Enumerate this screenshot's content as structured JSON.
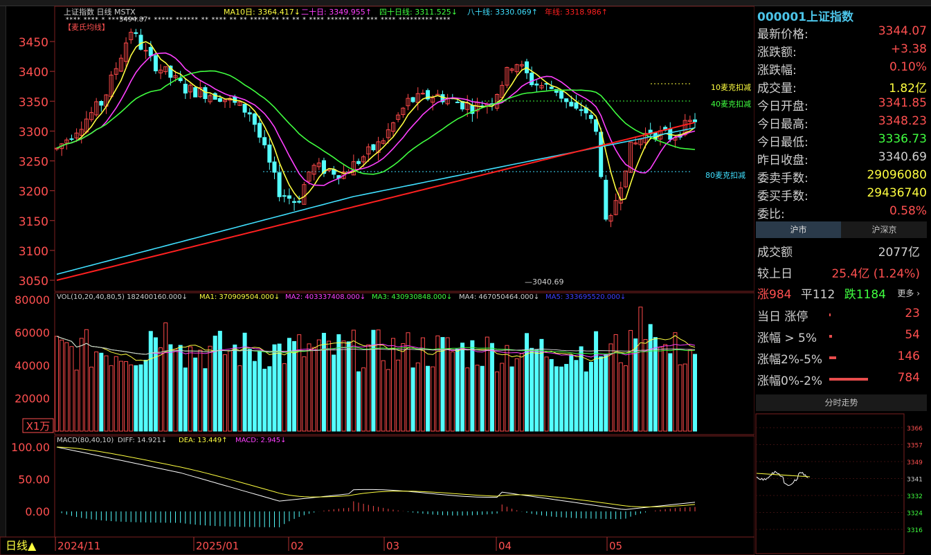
{
  "header": {
    "title": "上证指数",
    "period_tag": "日线",
    "indicator": "MSTX",
    "ma10_label": "MA10日: 3364.417↓",
    "ma20_label": "二十日: 3349.955↑",
    "ma40_label": "四十日线: 3311.525↓",
    "ma80_label": "八十线: 3330.069↑",
    "annual_label": "年线: 3318.986↑",
    "max_label": "3494.87",
    "min_label": "3040.69",
    "legend_tag": "【麦氏均线】",
    "mark10": "10麦克扣减",
    "mark40": "40麦克扣减",
    "mark80": "80麦克扣减"
  },
  "price_axis": [
    "3450",
    "3400",
    "3350",
    "3300",
    "3250",
    "3200",
    "3150",
    "3100",
    "3050"
  ],
  "vol_axis": [
    "80000",
    "60000",
    "40000",
    "20000"
  ],
  "vol_unit": "X1万",
  "vol_header": {
    "name": "VOL(10,20,40,80,5)",
    "v": "182400160.000↓",
    "ma1": "MA1: 370909504.000↓",
    "ma2": "MA2: 403337408.000↓",
    "ma3": "MA3: 430930848.000↓",
    "ma4": "MA4: 467050464.000↓",
    "ma5": "MA5: 333695520.000↓"
  },
  "macd_axis": [
    "100.00",
    "50.00",
    "0.00"
  ],
  "macd_header": {
    "name": "MACD(80,40,10)",
    "diff": "DIFF: 14.921↓",
    "dea": "DEA: 13.449↑",
    "macd": "MACD: 2.945↓"
  },
  "date_axis": [
    "2024/11",
    "2025/01",
    "02",
    "03",
    "04",
    "05"
  ],
  "period_button": "日线▲",
  "quote": {
    "code": "000001",
    "name": "上证指数",
    "rows": [
      {
        "k": "最新价格:",
        "v": "3344.07",
        "color": "#ff5050"
      },
      {
        "k": "涨跌额:",
        "v": "+3.38",
        "color": "#ff5050"
      },
      {
        "k": "涨跌幅:",
        "v": "0.10%",
        "color": "#ff5050"
      },
      {
        "k": "成交量:",
        "v": "1.82亿",
        "color": "#ffff40"
      },
      {
        "k": "今日开盘:",
        "v": "3341.85",
        "color": "#ff5050"
      },
      {
        "k": "今日最高:",
        "v": "3348.23",
        "color": "#ff5050"
      },
      {
        "k": "今日最低:",
        "v": "3336.73",
        "color": "#40ff40"
      },
      {
        "k": "昨日收盘:",
        "v": "3340.69",
        "color": "#d0d0d0"
      },
      {
        "k": "委卖手数:",
        "v": "29096080",
        "color": "#ffff40"
      },
      {
        "k": "委买手数:",
        "v": "29436740",
        "color": "#ffff40"
      },
      {
        "k": "委比:",
        "v": "0.58%",
        "color": "#ff5050"
      }
    ]
  },
  "tabs": [
    "沪市",
    "沪深京"
  ],
  "stats": {
    "turnover_label": "成交额",
    "turnover_value": "2077亿",
    "compare_label": "较上日",
    "compare_value": "25.4亿 (1.24%)",
    "up": "涨984",
    "flat": "平112",
    "down": "跌1184",
    "more": "更多 ›",
    "rows": [
      {
        "k": "当日 涨停",
        "v": "23",
        "w": 2
      },
      {
        "k": "涨幅 > 5%",
        "v": "54",
        "w": 4
      },
      {
        "k": "涨幅2%-5%",
        "v": "146",
        "w": 10
      },
      {
        "k": "涨幅0%-2%",
        "v": "784",
        "w": 56
      }
    ]
  },
  "intraday": {
    "title": "分时走势",
    "axis": [
      "3366",
      "3357",
      "3349",
      "3341",
      "3332",
      "3324",
      "3316"
    ]
  },
  "colors": {
    "up": "#ff4a4a",
    "down": "#54ffff",
    "ma10": "#ffff40",
    "ma20": "#ff40ff",
    "ma40": "#40ff40",
    "ma80": "#40e0ff",
    "year": "#ff2020"
  }
}
